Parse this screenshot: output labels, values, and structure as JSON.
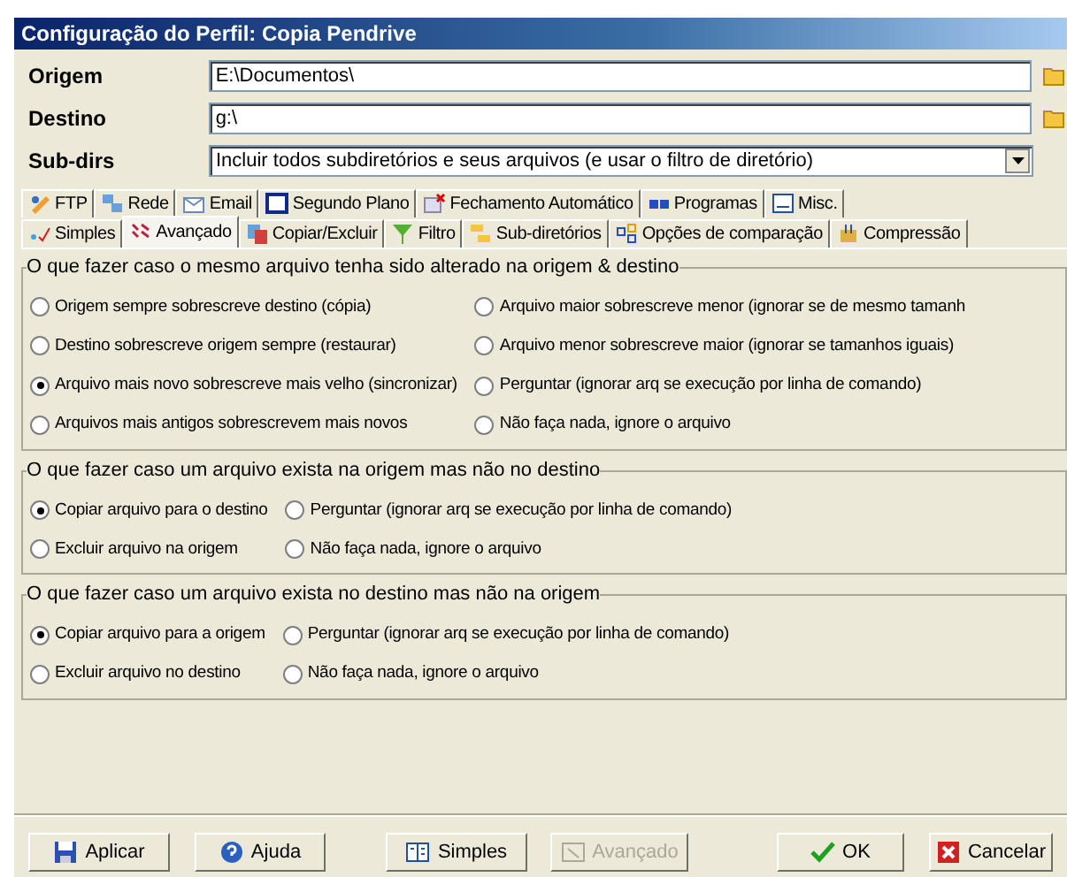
{
  "window": {
    "title": "Configuração do Perfil: Copia Pendrive"
  },
  "fields": [
    {
      "label": "Origem",
      "value": "E:\\Documentos\\",
      "kind": "path"
    },
    {
      "label": "Destino",
      "value": "g:\\",
      "kind": "path"
    },
    {
      "label": "Sub-dirs",
      "value": "Incluir todos subdiretórios e seus arquivos (e usar o filtro de diretório)",
      "kind": "dropdown"
    }
  ],
  "tab_rows": [
    [
      {
        "label": "FTP",
        "selected": false
      },
      {
        "label": "Rede",
        "selected": false
      },
      {
        "label": "Email",
        "selected": false
      },
      {
        "label": "Segundo Plano",
        "selected": false
      },
      {
        "label": "Fechamento Automático",
        "selected": false
      },
      {
        "label": "Programas",
        "selected": false
      },
      {
        "label": "Misc.",
        "selected": false
      }
    ],
    [
      {
        "label": "Simples",
        "selected": false
      },
      {
        "label": "Avançado",
        "selected": true
      },
      {
        "label": "Copiar/Excluir",
        "selected": false
      },
      {
        "label": "Filtro",
        "selected": false
      },
      {
        "label": "Sub-diretórios",
        "selected": false
      },
      {
        "label": "Opções de comparação",
        "selected": false
      },
      {
        "label": "Compressão",
        "selected": false
      }
    ]
  ],
  "groups": [
    {
      "title": "O que fazer caso o mesmo arquivo tenha sido alterado na origem & destino",
      "options": [
        {
          "label": "Origem sempre sobrescreve destino (cópia)",
          "selected": false
        },
        {
          "label": "Arquivo maior sobrescreve menor (ignorar se de mesmo tamanh",
          "selected": false
        },
        {
          "label": "Destino sobrescreve origem sempre (restaurar)",
          "selected": false
        },
        {
          "label": "Arquivo menor sobrescreve maior (ignorar se tamanhos iguais)",
          "selected": false
        },
        {
          "label": "Arquivo mais novo sobrescreve mais velho (sincronizar)",
          "selected": true
        },
        {
          "label": "Perguntar (ignorar arq se execução por linha de comando)",
          "selected": false
        },
        {
          "label": "Arquivos mais antigos sobrescrevem mais novos",
          "selected": false
        },
        {
          "label": "Não faça nada, ignore o arquivo",
          "selected": false
        }
      ]
    },
    {
      "title": "O que fazer caso um arquivo exista na origem mas não no destino",
      "options": [
        {
          "label": "Copiar arquivo para o destino",
          "selected": true
        },
        {
          "label": "Perguntar (ignorar arq se execução por linha de comando)",
          "selected": false
        },
        {
          "label": "Excluir arquivo na origem",
          "selected": false
        },
        {
          "label": "Não faça nada, ignore o arquivo",
          "selected": false
        }
      ]
    },
    {
      "title": "O que fazer caso um arquivo exista no destino mas não na origem",
      "options": [
        {
          "label": "Copiar arquivo para a origem",
          "selected": true
        },
        {
          "label": "Perguntar (ignorar arq se execução por linha de comando)",
          "selected": false
        },
        {
          "label": "Excluir arquivo no destino",
          "selected": false
        },
        {
          "label": "Não faça nada, ignore o arquivo",
          "selected": false
        }
      ]
    }
  ],
  "buttons": [
    {
      "label": "Aplicar",
      "kind": "save",
      "disabled": false
    },
    {
      "label": "Ajuda",
      "kind": "help",
      "disabled": false
    },
    {
      "label": "Simples",
      "kind": "simple",
      "disabled": false
    },
    {
      "label": "Avançado",
      "kind": "advanced",
      "disabled": true
    },
    {
      "label": "OK",
      "kind": "ok",
      "disabled": false
    },
    {
      "label": "Cancelar",
      "kind": "cancel",
      "disabled": false
    }
  ]
}
